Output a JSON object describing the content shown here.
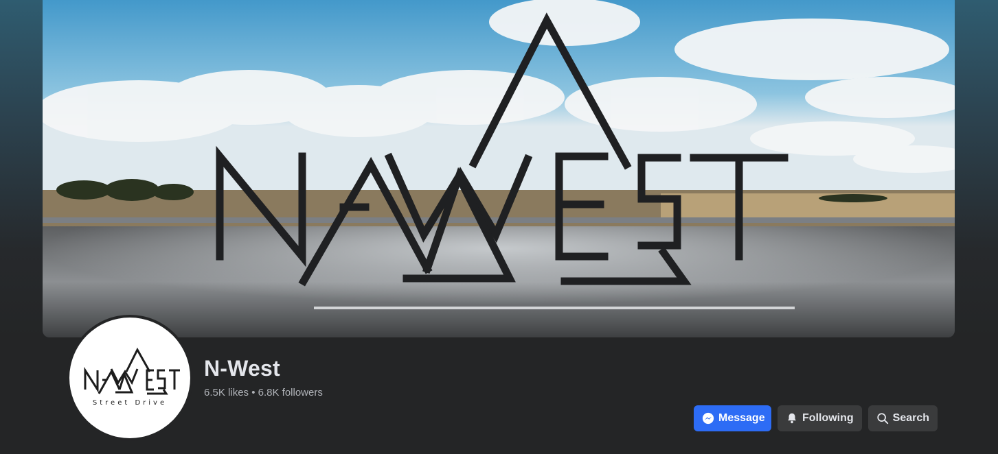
{
  "page": {
    "name": "N-West",
    "likes": "6.5K likes",
    "separator": " • ",
    "followers": "6.8K followers"
  },
  "cover": {
    "logo_text": "N-WEST"
  },
  "avatar": {
    "logo_text": "N-WEST",
    "tagline": "Street Drive"
  },
  "actions": {
    "message_label": "Message",
    "message_icon": "messenger-icon",
    "following_label": "Following",
    "following_icon": "bell-icon",
    "search_label": "Search",
    "search_icon": "search-icon"
  },
  "colors": {
    "primary": "#2d6cf5",
    "background": "#242526",
    "secondary_button": "#3a3b3c",
    "text": "#e4e6eb",
    "muted_text": "#b0b3b8"
  }
}
